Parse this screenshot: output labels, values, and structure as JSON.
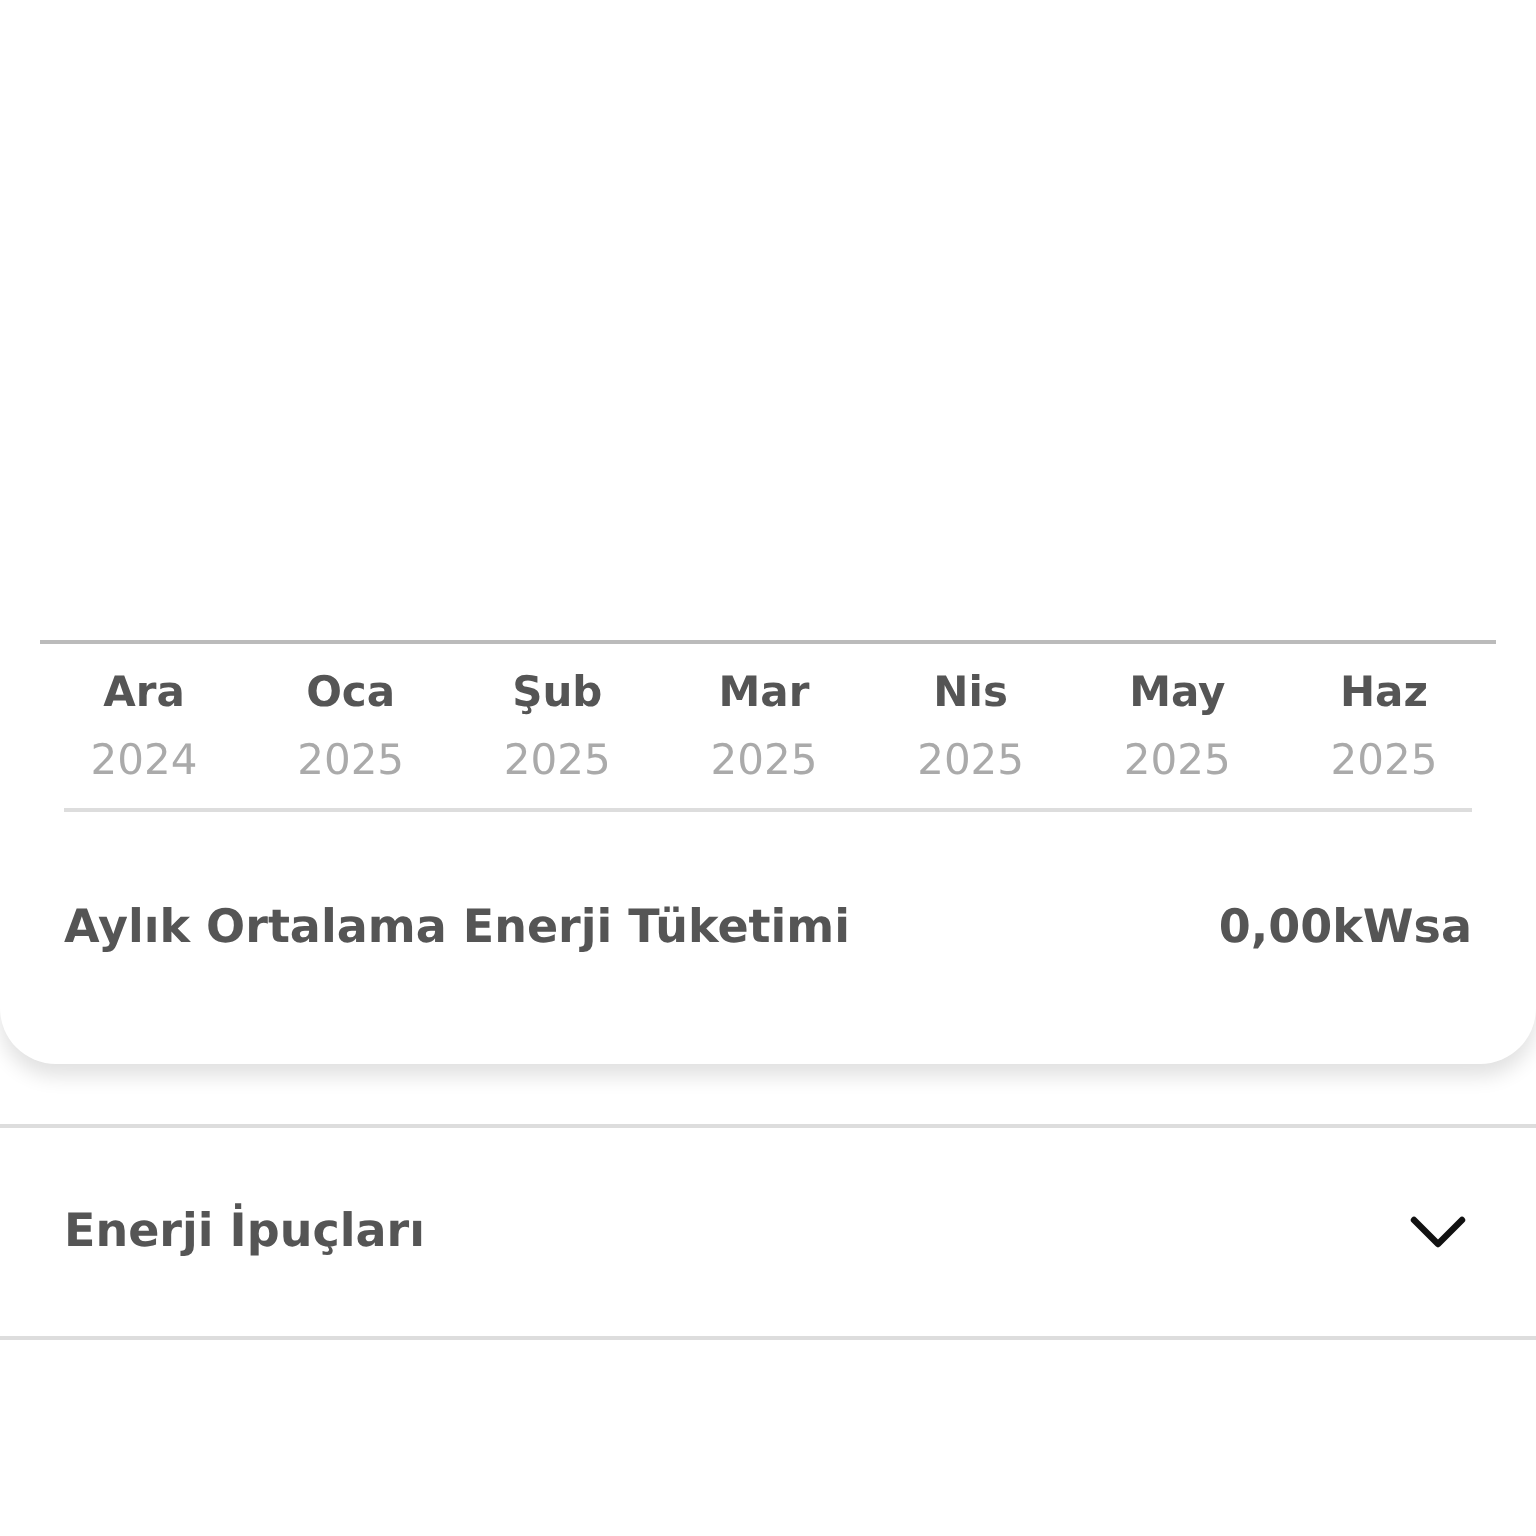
{
  "months": [
    {
      "label": "Ara",
      "year": "2024"
    },
    {
      "label": "Oca",
      "year": "2025"
    },
    {
      "label": "Şub",
      "year": "2025"
    },
    {
      "label": "Mar",
      "year": "2025"
    },
    {
      "label": "Nis",
      "year": "2025"
    },
    {
      "label": "May",
      "year": "2025"
    },
    {
      "label": "Haz",
      "year": "2025"
    }
  ],
  "summary": {
    "label": "Aylık Ortalama Enerji Tüketimi",
    "value": "0,00kWsa"
  },
  "accordion": {
    "title": "Enerji İpuçları",
    "expanded": false
  }
}
